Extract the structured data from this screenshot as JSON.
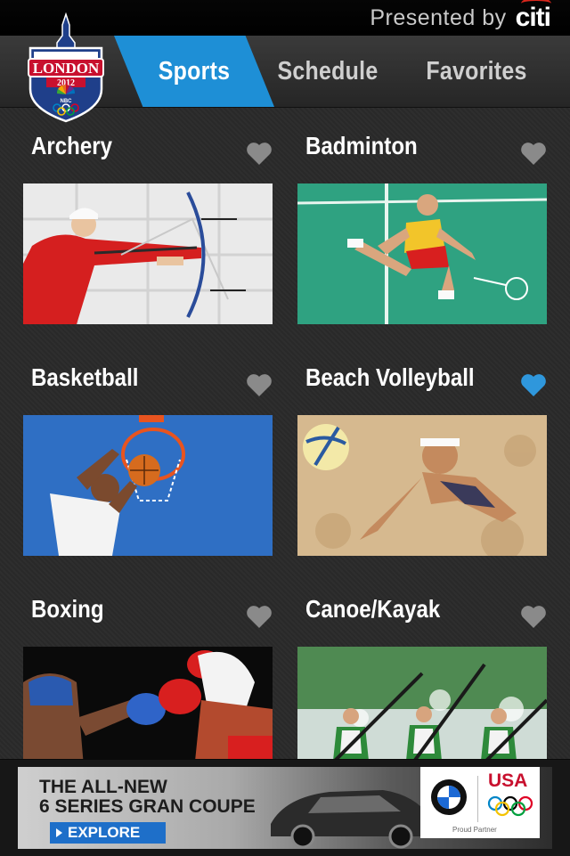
{
  "status": {
    "presented_by": "Presented by",
    "sponsor": "citi"
  },
  "logo": {
    "city": "LONDON",
    "year": "2012",
    "network": "NBC"
  },
  "tabs": [
    {
      "label": "Sports",
      "active": true
    },
    {
      "label": "Schedule",
      "active": false
    },
    {
      "label": "Favorites",
      "active": false
    }
  ],
  "sports": [
    {
      "name": "Archery",
      "favorite": false
    },
    {
      "name": "Badminton",
      "favorite": false
    },
    {
      "name": "Basketball",
      "favorite": false
    },
    {
      "name": "Beach Volleyball",
      "favorite": true
    },
    {
      "name": "Boxing",
      "favorite": false
    },
    {
      "name": "Canoe/Kayak",
      "favorite": false
    }
  ],
  "ad": {
    "headline": "THE ALL-NEW\n6 SERIES GRAN COUPE",
    "cta": "EXPLORE",
    "badge": "USA",
    "partner": "Proud Partner"
  },
  "colors": {
    "accent": "#1e8fd6",
    "heart_active": "#2f97dc",
    "heart_inactive": "#8a8a8a"
  }
}
